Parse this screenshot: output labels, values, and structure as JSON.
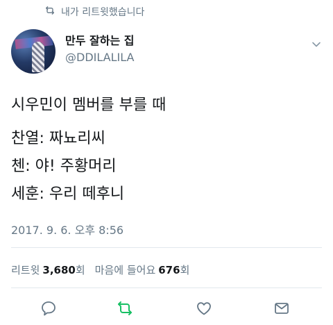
{
  "retweet_header": {
    "icon": "retweet-icon",
    "label": "내가 리트윗했습니다"
  },
  "author": {
    "display_name": "만두 잘하는 집",
    "handle": "@DDILALILA",
    "avatar": "avatar"
  },
  "tweet": {
    "lines": [
      "시우민이 멤버를 부를 때",
      "찬열:  짜뇨리씨",
      "첸:  야! 주황머리",
      "세훈: 우리 떼후니"
    ],
    "timestamp": "2017. 9. 6. 오후 8:56"
  },
  "stats": {
    "retweets_label": "리트윗",
    "retweets_count": "3,680",
    "retweets_unit": "회",
    "likes_label": "마음에 들어요",
    "likes_count": "676",
    "likes_unit": "회"
  },
  "actions": {
    "reply": "reply-icon",
    "retweet": "retweet-icon",
    "like": "heart-icon",
    "message": "envelope-icon",
    "retweet_active_color": "#17bf63"
  },
  "colors": {
    "secondary_text": "#657786",
    "primary_text": "#14171a",
    "divider": "#e1e8ed"
  }
}
